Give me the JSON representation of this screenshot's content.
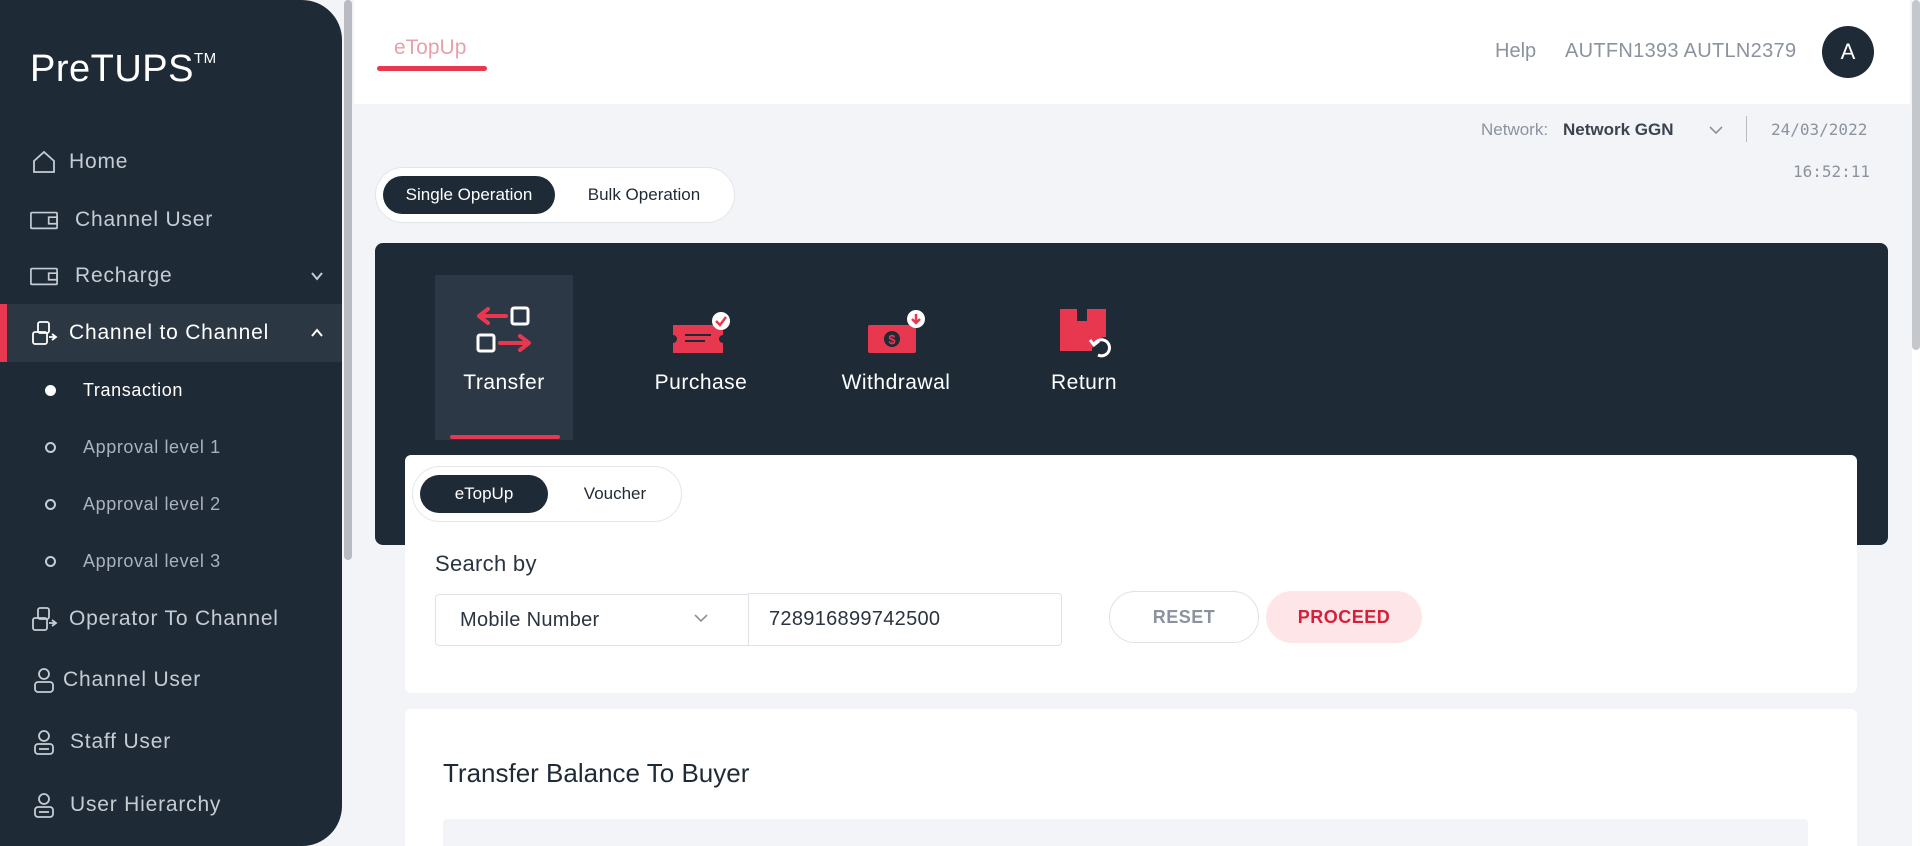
{
  "app": {
    "logo": "PreTUPS",
    "logo_tm": "TM"
  },
  "sidebar": {
    "items": [
      {
        "label": "Home",
        "icon": "home-icon"
      },
      {
        "label": "Channel User",
        "icon": "wallet-icon"
      },
      {
        "label": "Recharge",
        "icon": "wallet-icon"
      },
      {
        "label": "Channel to Channel",
        "icon": "transfer-users-icon"
      },
      {
        "label": "Operator To Channel",
        "icon": "transfer-users-icon"
      },
      {
        "label": "Channel User",
        "icon": "user-icon"
      },
      {
        "label": "Staff User",
        "icon": "user-icon"
      },
      {
        "label": "User Hierarchy",
        "icon": "user-icon"
      }
    ],
    "sub_items": [
      {
        "label": "Transaction"
      },
      {
        "label": "Approval level 1"
      },
      {
        "label": "Approval level 2"
      },
      {
        "label": "Approval level 3"
      }
    ]
  },
  "header": {
    "tab": "eTopUp",
    "help": "Help",
    "username": "AUTFN1393 AUTLN2379",
    "avatar_letter": "A"
  },
  "meta": {
    "network_label": "Network:",
    "network_value": "Network GGN",
    "date": "24/03/2022",
    "time": "16:52:11"
  },
  "operation_toggle": {
    "single": "Single Operation",
    "bulk": "Bulk Operation"
  },
  "operations": [
    {
      "label": "Transfer",
      "icon": "transfer-icon"
    },
    {
      "label": "Purchase",
      "icon": "purchase-icon"
    },
    {
      "label": "Withdrawal",
      "icon": "withdrawal-icon"
    },
    {
      "label": "Return",
      "icon": "return-icon"
    }
  ],
  "type_toggle": {
    "etopup": "eTopUp",
    "voucher": "Voucher"
  },
  "search": {
    "label": "Search by",
    "selected": "Mobile Number",
    "value": "728916899742500",
    "reset": "RESET",
    "proceed": "PROCEED"
  },
  "section": {
    "title": "Transfer Balance To Buyer"
  },
  "colors": {
    "accent": "#e8384f",
    "dark": "#1f2a37",
    "background": "#f3f4f8"
  }
}
